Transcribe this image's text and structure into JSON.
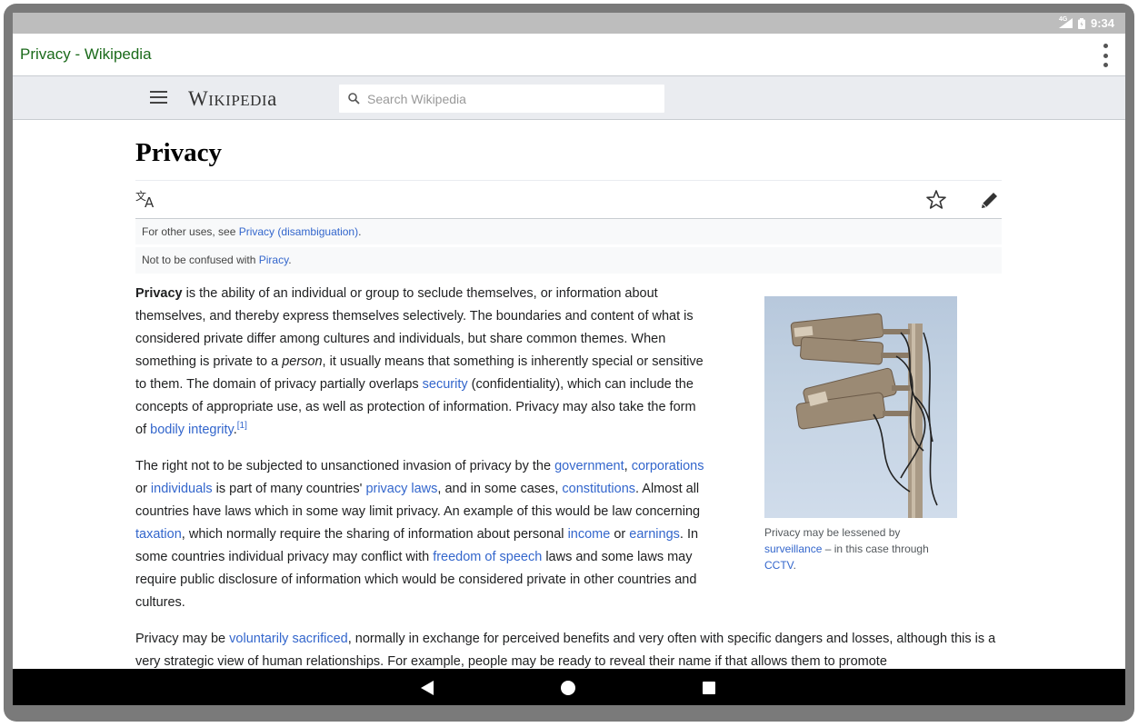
{
  "status_bar": {
    "network": "4G",
    "time": "9:34"
  },
  "app_bar": {
    "title": "Privacy - Wikipedia"
  },
  "wiki_header": {
    "logo_text": "Wikipedia",
    "search_placeholder": "Search Wikipedia"
  },
  "article": {
    "title": "Privacy",
    "hatnotes": [
      {
        "prefix": "For other uses, see ",
        "link": "Privacy (disambiguation)",
        "suffix": "."
      },
      {
        "prefix": "Not to be confused with ",
        "link": "Piracy",
        "suffix": "."
      }
    ],
    "p1": {
      "bold": "Privacy",
      "t1": " is the ability of an individual or group to seclude themselves, or information about themselves, and thereby express themselves selectively. The boundaries and content of what is considered private differ among cultures and individuals, but share common themes. When something is private to a ",
      "italic": "person",
      "t2": ", it usually means that something is inherently special or sensitive to them. The domain of privacy partially overlaps ",
      "link_security": "security",
      "t3": " (confidentiality), which can include the concepts of appropriate use, as well as protection of information. Privacy may also take the form of ",
      "link_bodily": "bodily integrity",
      "t4": ".",
      "ref": "[1]"
    },
    "p2": {
      "t1": "The right not to be subjected to unsanctioned invasion of privacy by the ",
      "link_government": "government",
      "t2": ", ",
      "link_corporations": "corporations",
      "t3": " or ",
      "link_individuals": "individuals",
      "t4": " is part of many countries' ",
      "link_privacy_laws": "privacy laws",
      "t5": ", and in some cases, ",
      "link_constitutions": "constitutions",
      "t6": ". Almost all countries have laws which in some way limit privacy. An example of this would be law concerning ",
      "link_taxation": "taxation",
      "t7": ", which normally require the sharing of information about personal ",
      "link_income": "income",
      "t8": " or ",
      "link_earnings": "earnings",
      "t9": ". In some countries individual privacy may conflict with ",
      "link_freedom": "freedom of speech",
      "t10": " laws and some laws may require public disclosure of information which would be considered private in other countries and cultures."
    },
    "p3": {
      "t1": "Privacy may be ",
      "link_voluntarily": "voluntarily sacrificed",
      "t2": ", normally in exchange for perceived benefits and very often with specific dangers and losses, although this is a very strategic view of human relationships. For example, people may be ready to reveal their name if that allows them to promote"
    },
    "thumbnail": {
      "caption_t1": "Privacy may be lessened by ",
      "caption_link1": "surveillance",
      "caption_t2": " – in this case through ",
      "caption_link2": "CCTV",
      "caption_t3": "."
    }
  },
  "colors": {
    "link": "#3366cc",
    "app_title": "#1b6a1b",
    "header_bg": "#eaecf0"
  }
}
